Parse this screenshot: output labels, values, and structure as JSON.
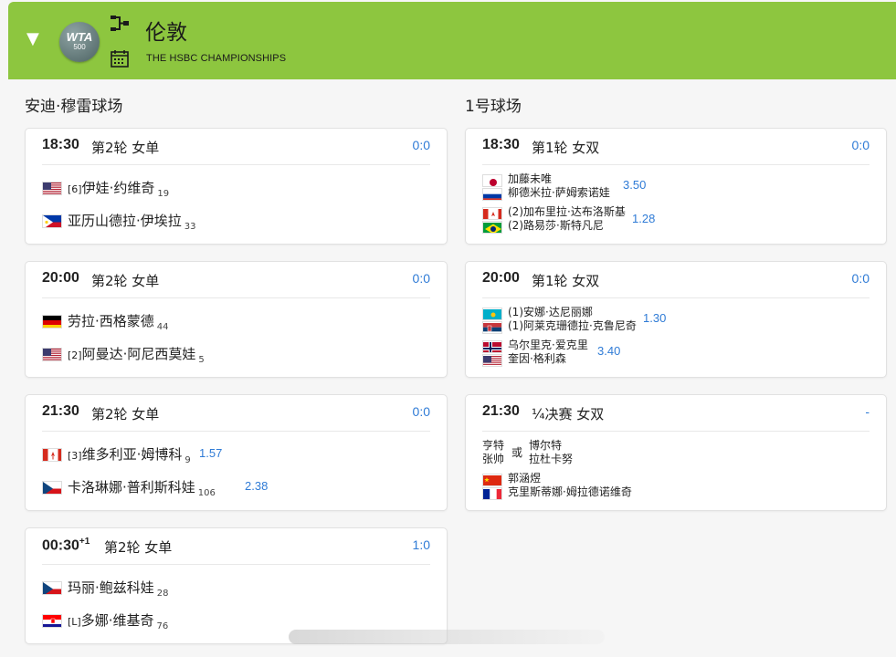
{
  "header": {
    "city": "伦敦",
    "tournament": "THE HSBC CHAMPIONSHIPS",
    "logo_top": "WTA",
    "logo_bottom": "500",
    "color": "#8dc63f"
  },
  "courts": [
    {
      "name": "安迪·穆雷球场",
      "matches": [
        {
          "time": "18:30",
          "time_sup": "",
          "round": "第2轮 女单",
          "score": "0:0",
          "players": [
            {
              "flag": "us",
              "seed": "[6]",
              "name": "伊娃·约维奇",
              "rank": "19",
              "odds": ""
            },
            {
              "flag": "ph",
              "seed": "",
              "name": "亚历山德拉·伊埃拉",
              "rank": "33",
              "odds": ""
            }
          ]
        },
        {
          "time": "20:00",
          "time_sup": "",
          "round": "第2轮 女单",
          "score": "0:0",
          "players": [
            {
              "flag": "de",
              "seed": "",
              "name": "劳拉·西格蒙德",
              "rank": "44",
              "odds": ""
            },
            {
              "flag": "us",
              "seed": "[2]",
              "name": "阿曼达·阿尼西莫娃",
              "rank": "5",
              "odds": ""
            }
          ]
        },
        {
          "time": "21:30",
          "time_sup": "",
          "round": "第2轮 女单",
          "score": "0:0",
          "players": [
            {
              "flag": "ca",
              "seed": "[3]",
              "name": "维多利亚·姆博科",
              "rank": "9",
              "odds": "1.57"
            },
            {
              "flag": "cz",
              "seed": "",
              "name": "卡洛琳娜·普利斯科娃",
              "rank": "106",
              "odds": "2.38"
            }
          ]
        },
        {
          "time": "00:30",
          "time_sup": "+1",
          "round": "第2轮 女单",
          "score": "1:0",
          "players": [
            {
              "flag": "cz",
              "seed": "",
              "name": "玛丽·鲍兹科娃",
              "rank": "28",
              "odds": ""
            },
            {
              "flag": "hr",
              "seed": "[L]",
              "name": "多娜·维基奇",
              "rank": "76",
              "odds": ""
            }
          ]
        }
      ]
    },
    {
      "name": "1号球场",
      "matches": [
        {
          "time": "18:30",
          "round": "第1轮 女双",
          "score": "0:0",
          "teams": [
            {
              "flags": [
                "jp",
                "ru"
              ],
              "names": [
                "加藤未唯",
                "柳德米拉·萨姆索诺娃"
              ],
              "odds": "3.50"
            },
            {
              "flags": [
                "ca",
                "br"
              ],
              "names": [
                "(2)加布里拉·达布洛斯基",
                "(2)路易莎·斯特凡尼"
              ],
              "odds": "1.28"
            }
          ]
        },
        {
          "time": "20:00",
          "round": "第1轮 女双",
          "score": "0:0",
          "teams": [
            {
              "flags": [
                "kz",
                "rs"
              ],
              "names": [
                "(1)安娜·达尼丽娜",
                "(1)阿莱克珊德拉·克鲁尼奇"
              ],
              "odds": "1.30"
            },
            {
              "flags": [
                "no",
                "us"
              ],
              "names": [
                "乌尔里克·爱克里",
                "奎因·格利森"
              ],
              "odds": "3.40"
            }
          ]
        },
        {
          "time": "21:30",
          "round": "¼决赛 女双",
          "score": "-",
          "tbd": {
            "a1": "亨特",
            "a2": "张帅",
            "or": "或",
            "b1": "博尔特",
            "b2": "拉杜卡努"
          },
          "team": {
            "flags": [
              "cn",
              "fr"
            ],
            "names": [
              "郭涵煜",
              "克里斯蒂娜·姆拉德诺维奇"
            ]
          }
        }
      ]
    }
  ]
}
